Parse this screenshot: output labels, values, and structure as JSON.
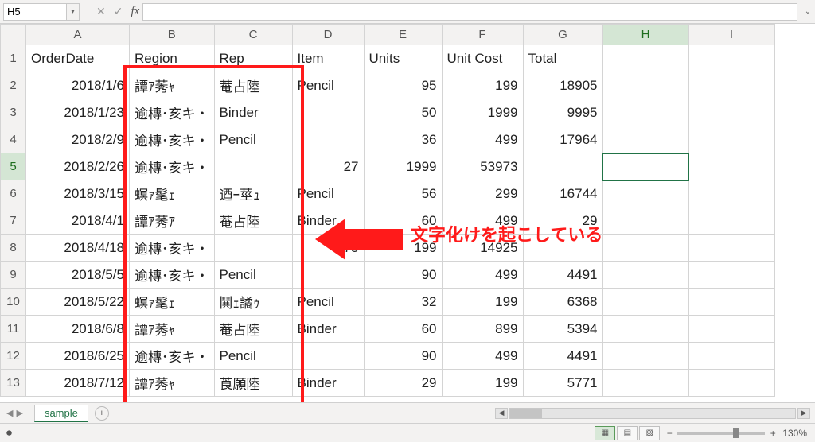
{
  "namebox": {
    "value": "H5"
  },
  "fx": {
    "x": "✕",
    "check": "✓",
    "label": "fx",
    "value": ""
  },
  "columns": [
    "A",
    "B",
    "C",
    "D",
    "E",
    "F",
    "G",
    "H",
    "I"
  ],
  "headers": {
    "A": "OrderDate",
    "B": "Region",
    "C": "Rep",
    "D": "Item",
    "E": "Units",
    "F": "Unit Cost",
    "G": "Total"
  },
  "rows": [
    {
      "n": 1,
      "A": "OrderDate",
      "B": "Region",
      "C": "Rep",
      "D": "Item",
      "E": "Units",
      "F": "Unit Cost",
      "G": "Total",
      "align": "header"
    },
    {
      "n": 2,
      "A": "2018/1/6",
      "B": "譚ｱ莠ｬ",
      "C": "菴占陸",
      "D": "Pencil",
      "E": "95",
      "F": "199",
      "G": "18905"
    },
    {
      "n": 3,
      "A": "2018/1/23",
      "B": "逾槫･亥キ・",
      "C": "Binder",
      "D": "",
      "E": "50",
      "F": "1999",
      "G": "9995"
    },
    {
      "n": 4,
      "A": "2018/2/9",
      "B": "逾槫･亥キ・",
      "C": "Pencil",
      "D": "",
      "E": "36",
      "F": "499",
      "G": "17964"
    },
    {
      "n": 5,
      "A": "2018/2/26",
      "B": "逾槫･亥キ・",
      "C": "",
      "D": "27",
      "E": "1999",
      "F": "53973",
      "G": ""
    },
    {
      "n": 6,
      "A": "2018/3/15",
      "B": "螟ｧ髦ｪ",
      "C": "逎ｰ莖ｭ",
      "D": "Pencil",
      "E": "56",
      "F": "299",
      "G": "16744"
    },
    {
      "n": 7,
      "A": "2018/4/1",
      "B": "譚ｱ莠ｱ",
      "C": "菴占陸",
      "D": "Binder",
      "E": "60",
      "F": "499",
      "G": "29",
      "G2": ""
    },
    {
      "n": 8,
      "A": "2018/4/18",
      "B": "逾槫･亥キ・",
      "C": "",
      "D": "75",
      "E": "199",
      "F": "14925",
      "G": ""
    },
    {
      "n": 9,
      "A": "2018/5/5",
      "B": "逾槫･亥キ・",
      "C": "Pencil",
      "D": "",
      "E": "90",
      "F": "499",
      "G": "4491"
    },
    {
      "n": 10,
      "A": "2018/5/22",
      "B": "螟ｧ髦ｪ",
      "C": "鬨ｪ譎ｩ",
      "D": "Pencil",
      "E": "32",
      "F": "199",
      "G": "6368"
    },
    {
      "n": 11,
      "A": "2018/6/8",
      "B": "譚ｱ莠ｬ",
      "C": "菴占陸",
      "D": "Binder",
      "E": "60",
      "F": "899",
      "G": "5394"
    },
    {
      "n": 12,
      "A": "2018/6/25",
      "B": "逾槫･亥キ・",
      "C": "Pencil",
      "D": "",
      "E": "90",
      "F": "499",
      "G": "4491"
    },
    {
      "n": 13,
      "A": "2018/7/12",
      "B": "譚ｱ莠ｬ",
      "C": "莨願陸",
      "D": "Binder",
      "E": "29",
      "F": "199",
      "G": "5771"
    }
  ],
  "annotation": {
    "label": "文字化けを起こしている"
  },
  "sheet": {
    "name": "sample",
    "add": "+"
  },
  "status": {
    "ready_icon": "⏺",
    "zoom": "130%"
  },
  "active": {
    "col": "H",
    "row": 5
  }
}
